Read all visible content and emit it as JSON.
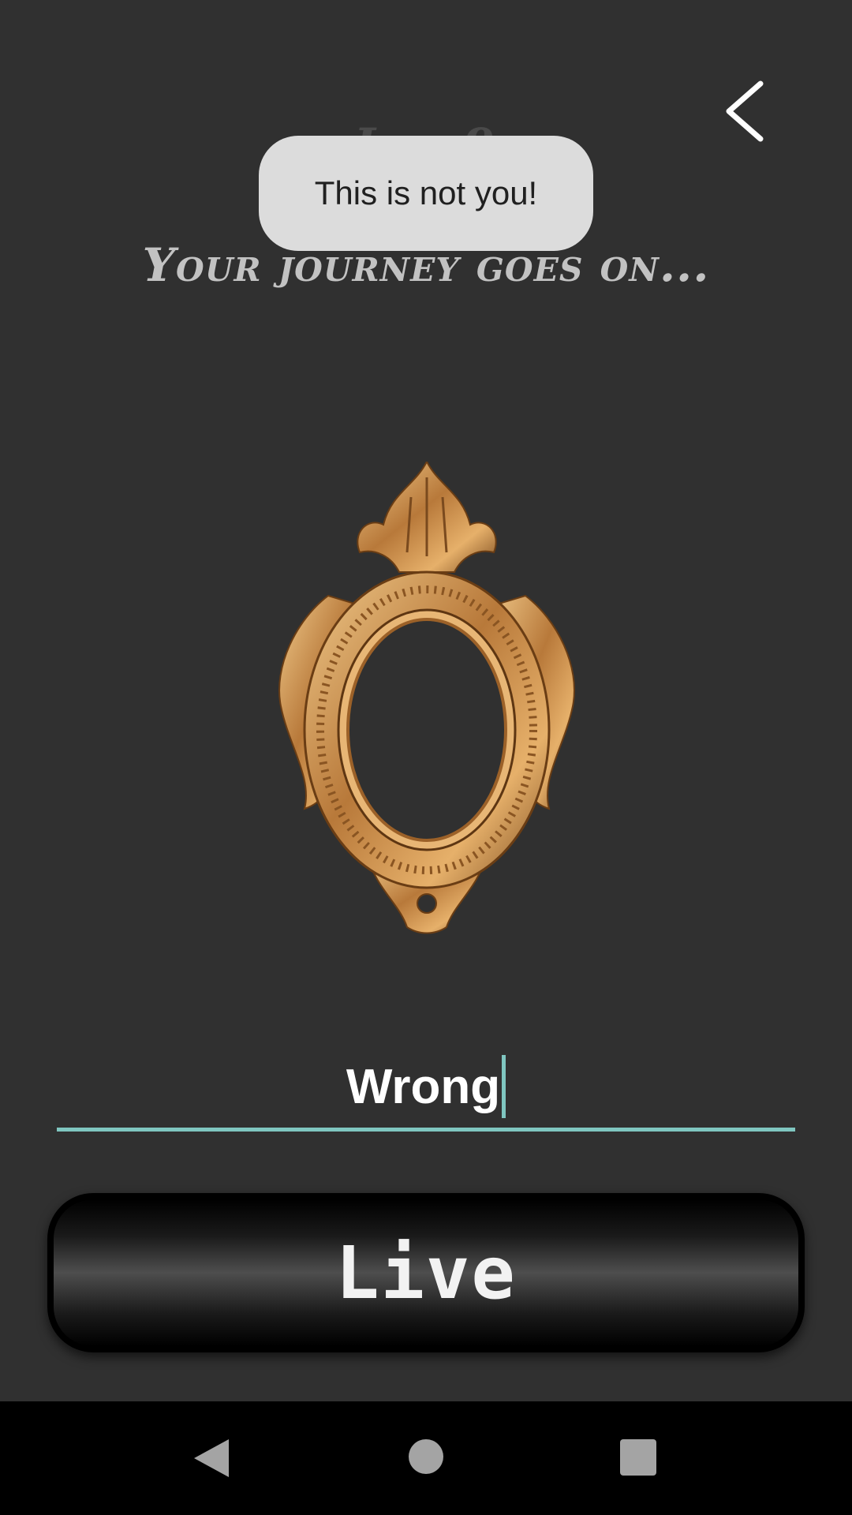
{
  "header": {
    "back_icon": "chevron-left-icon",
    "level_label": "Lvl 9",
    "subtitle": "Your journey goes on..."
  },
  "toast": {
    "message": "This is not you!"
  },
  "mirror": {
    "icon": "ornate-gold-mirror-frame"
  },
  "answer": {
    "value": "Wrong",
    "underline_color": "#7fc6c0"
  },
  "submit": {
    "label": "Live"
  },
  "system_nav": {
    "back_icon": "triangle-back-icon",
    "home_icon": "circle-home-icon",
    "recents_icon": "square-recents-icon"
  },
  "colors": {
    "background": "#303030",
    "frame_gold": "#c98a45",
    "toast_bg": "#dcdcdc"
  }
}
